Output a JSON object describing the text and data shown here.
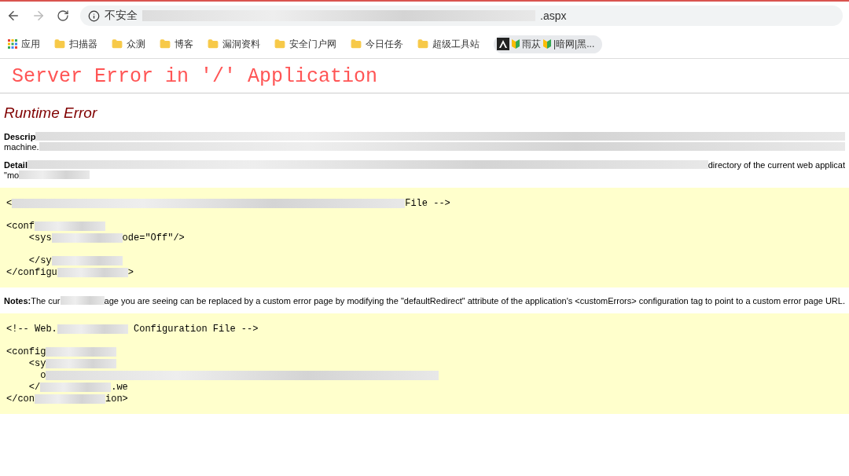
{
  "browser": {
    "security_label": "不安全",
    "url": [
      {
        "kind": "blur-long"
      },
      {
        "kind": "text",
        "text": ".aspx"
      }
    ],
    "bookmarks": [
      {
        "kind": "apps",
        "label": "应用"
      },
      {
        "kind": "folder",
        "label": "扫描器"
      },
      {
        "kind": "folder",
        "label": "众测"
      },
      {
        "kind": "folder",
        "label": "博客"
      },
      {
        "kind": "folder",
        "label": "漏洞资料"
      },
      {
        "kind": "folder",
        "label": "安全门户网"
      },
      {
        "kind": "folder",
        "label": "今日任务"
      },
      {
        "kind": "folder",
        "label": "超级工具站"
      },
      {
        "kind": "site",
        "label": "雨苁",
        "label_2": "|暗网|黑..."
      }
    ]
  },
  "page": {
    "title": "Server Error in '/' Application",
    "subtitle": "Runtime Error",
    "description": [
      [
        {
          "kind": "bold",
          "text": "Descrip"
        },
        {
          "kind": "blur-fill"
        }
      ],
      [
        {
          "kind": "text",
          "text": "machine."
        },
        {
          "kind": "blur-fill"
        }
      ]
    ],
    "details": [
      [
        {
          "kind": "bold",
          "text": "Detail"
        },
        {
          "kind": "blur-fill"
        },
        {
          "kind": "text",
          "text": "directory of the current web applicat"
        }
      ],
      [
        {
          "kind": "text",
          "text": "\"mo"
        },
        {
          "kind": "blur"
        }
      ]
    ],
    "code_1": [
      [
        {
          "kind": "text",
          "text": "<"
        },
        {
          "kind": "blur-long"
        },
        {
          "kind": "text",
          "text": "File -->"
        }
      ],
      [
        {
          "kind": "gap"
        },
        {
          "kind": "text",
          "text": "<conf"
        },
        {
          "kind": "blur"
        }
      ],
      [
        {
          "kind": "text",
          "text": "    <sys"
        },
        {
          "kind": "blur"
        },
        {
          "kind": "text",
          "text": "ode=\"Off\"/>"
        }
      ],
      [
        {
          "kind": "gap"
        },
        {
          "kind": "text",
          "text": "    </sy"
        },
        {
          "kind": "blur"
        }
      ],
      [
        {
          "kind": "text",
          "text": "</configu"
        },
        {
          "kind": "blur"
        },
        {
          "kind": "text",
          "text": ">"
        }
      ]
    ],
    "notes": [
      {
        "kind": "bold",
        "text": "Notes:"
      },
      {
        "kind": "text",
        "text": "The cur"
      },
      {
        "kind": "blur"
      },
      {
        "kind": "text",
        "text": "age you are seeing can be replaced by a custom error page by modifying the \"defaultRedirect\" attribute of the application's <customErrors> configuration tag to point to a custom error page URL."
      }
    ],
    "code_2": [
      [
        {
          "kind": "text",
          "text": "<!-- Web."
        },
        {
          "kind": "blur"
        },
        {
          "kind": "text",
          "text": " Configuration File -->"
        }
      ],
      [
        {
          "kind": "gap"
        },
        {
          "kind": "text",
          "text": "<config"
        },
        {
          "kind": "blur"
        }
      ],
      [
        {
          "kind": "text",
          "text": "    <sy"
        },
        {
          "kind": "blur"
        }
      ],
      [
        {
          "kind": "text",
          "text": "      o"
        },
        {
          "kind": "blur-long"
        }
      ],
      [
        {
          "kind": "text",
          "text": "    </"
        },
        {
          "kind": "blur"
        },
        {
          "kind": "text",
          "text": ".we"
        }
      ],
      [
        {
          "kind": "text",
          "text": "</con"
        },
        {
          "kind": "blur"
        },
        {
          "kind": "text",
          "text": "ion>"
        }
      ]
    ]
  }
}
